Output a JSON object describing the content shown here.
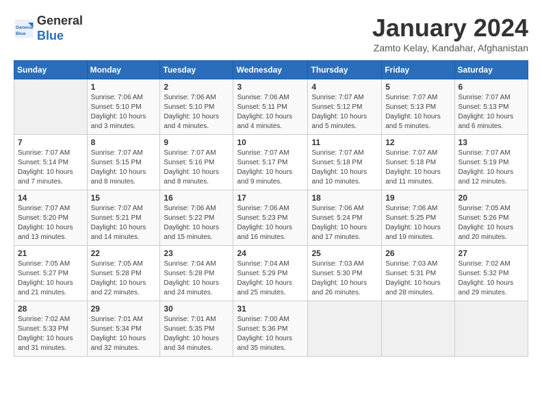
{
  "header": {
    "logo_general": "General",
    "logo_blue": "Blue",
    "month_title": "January 2024",
    "location": "Zamto Kelay, Kandahar, Afghanistan"
  },
  "days_of_week": [
    "Sunday",
    "Monday",
    "Tuesday",
    "Wednesday",
    "Thursday",
    "Friday",
    "Saturday"
  ],
  "weeks": [
    [
      {
        "day": "",
        "sunrise": "",
        "sunset": "",
        "daylight": ""
      },
      {
        "day": "1",
        "sunrise": "Sunrise: 7:06 AM",
        "sunset": "Sunset: 5:10 PM",
        "daylight": "Daylight: 10 hours and 3 minutes."
      },
      {
        "day": "2",
        "sunrise": "Sunrise: 7:06 AM",
        "sunset": "Sunset: 5:10 PM",
        "daylight": "Daylight: 10 hours and 4 minutes."
      },
      {
        "day": "3",
        "sunrise": "Sunrise: 7:06 AM",
        "sunset": "Sunset: 5:11 PM",
        "daylight": "Daylight: 10 hours and 4 minutes."
      },
      {
        "day": "4",
        "sunrise": "Sunrise: 7:07 AM",
        "sunset": "Sunset: 5:12 PM",
        "daylight": "Daylight: 10 hours and 5 minutes."
      },
      {
        "day": "5",
        "sunrise": "Sunrise: 7:07 AM",
        "sunset": "Sunset: 5:13 PM",
        "daylight": "Daylight: 10 hours and 5 minutes."
      },
      {
        "day": "6",
        "sunrise": "Sunrise: 7:07 AM",
        "sunset": "Sunset: 5:13 PM",
        "daylight": "Daylight: 10 hours and 6 minutes."
      }
    ],
    [
      {
        "day": "7",
        "sunrise": "Sunrise: 7:07 AM",
        "sunset": "Sunset: 5:14 PM",
        "daylight": "Daylight: 10 hours and 7 minutes."
      },
      {
        "day": "8",
        "sunrise": "Sunrise: 7:07 AM",
        "sunset": "Sunset: 5:15 PM",
        "daylight": "Daylight: 10 hours and 8 minutes."
      },
      {
        "day": "9",
        "sunrise": "Sunrise: 7:07 AM",
        "sunset": "Sunset: 5:16 PM",
        "daylight": "Daylight: 10 hours and 8 minutes."
      },
      {
        "day": "10",
        "sunrise": "Sunrise: 7:07 AM",
        "sunset": "Sunset: 5:17 PM",
        "daylight": "Daylight: 10 hours and 9 minutes."
      },
      {
        "day": "11",
        "sunrise": "Sunrise: 7:07 AM",
        "sunset": "Sunset: 5:18 PM",
        "daylight": "Daylight: 10 hours and 10 minutes."
      },
      {
        "day": "12",
        "sunrise": "Sunrise: 7:07 AM",
        "sunset": "Sunset: 5:18 PM",
        "daylight": "Daylight: 10 hours and 11 minutes."
      },
      {
        "day": "13",
        "sunrise": "Sunrise: 7:07 AM",
        "sunset": "Sunset: 5:19 PM",
        "daylight": "Daylight: 10 hours and 12 minutes."
      }
    ],
    [
      {
        "day": "14",
        "sunrise": "Sunrise: 7:07 AM",
        "sunset": "Sunset: 5:20 PM",
        "daylight": "Daylight: 10 hours and 13 minutes."
      },
      {
        "day": "15",
        "sunrise": "Sunrise: 7:07 AM",
        "sunset": "Sunset: 5:21 PM",
        "daylight": "Daylight: 10 hours and 14 minutes."
      },
      {
        "day": "16",
        "sunrise": "Sunrise: 7:06 AM",
        "sunset": "Sunset: 5:22 PM",
        "daylight": "Daylight: 10 hours and 15 minutes."
      },
      {
        "day": "17",
        "sunrise": "Sunrise: 7:06 AM",
        "sunset": "Sunset: 5:23 PM",
        "daylight": "Daylight: 10 hours and 16 minutes."
      },
      {
        "day": "18",
        "sunrise": "Sunrise: 7:06 AM",
        "sunset": "Sunset: 5:24 PM",
        "daylight": "Daylight: 10 hours and 17 minutes."
      },
      {
        "day": "19",
        "sunrise": "Sunrise: 7:06 AM",
        "sunset": "Sunset: 5:25 PM",
        "daylight": "Daylight: 10 hours and 19 minutes."
      },
      {
        "day": "20",
        "sunrise": "Sunrise: 7:05 AM",
        "sunset": "Sunset: 5:26 PM",
        "daylight": "Daylight: 10 hours and 20 minutes."
      }
    ],
    [
      {
        "day": "21",
        "sunrise": "Sunrise: 7:05 AM",
        "sunset": "Sunset: 5:27 PM",
        "daylight": "Daylight: 10 hours and 21 minutes."
      },
      {
        "day": "22",
        "sunrise": "Sunrise: 7:05 AM",
        "sunset": "Sunset: 5:28 PM",
        "daylight": "Daylight: 10 hours and 22 minutes."
      },
      {
        "day": "23",
        "sunrise": "Sunrise: 7:04 AM",
        "sunset": "Sunset: 5:28 PM",
        "daylight": "Daylight: 10 hours and 24 minutes."
      },
      {
        "day": "24",
        "sunrise": "Sunrise: 7:04 AM",
        "sunset": "Sunset: 5:29 PM",
        "daylight": "Daylight: 10 hours and 25 minutes."
      },
      {
        "day": "25",
        "sunrise": "Sunrise: 7:03 AM",
        "sunset": "Sunset: 5:30 PM",
        "daylight": "Daylight: 10 hours and 26 minutes."
      },
      {
        "day": "26",
        "sunrise": "Sunrise: 7:03 AM",
        "sunset": "Sunset: 5:31 PM",
        "daylight": "Daylight: 10 hours and 28 minutes."
      },
      {
        "day": "27",
        "sunrise": "Sunrise: 7:02 AM",
        "sunset": "Sunset: 5:32 PM",
        "daylight": "Daylight: 10 hours and 29 minutes."
      }
    ],
    [
      {
        "day": "28",
        "sunrise": "Sunrise: 7:02 AM",
        "sunset": "Sunset: 5:33 PM",
        "daylight": "Daylight: 10 hours and 31 minutes."
      },
      {
        "day": "29",
        "sunrise": "Sunrise: 7:01 AM",
        "sunset": "Sunset: 5:34 PM",
        "daylight": "Daylight: 10 hours and 32 minutes."
      },
      {
        "day": "30",
        "sunrise": "Sunrise: 7:01 AM",
        "sunset": "Sunset: 5:35 PM",
        "daylight": "Daylight: 10 hours and 34 minutes."
      },
      {
        "day": "31",
        "sunrise": "Sunrise: 7:00 AM",
        "sunset": "Sunset: 5:36 PM",
        "daylight": "Daylight: 10 hours and 35 minutes."
      },
      {
        "day": "",
        "sunrise": "",
        "sunset": "",
        "daylight": ""
      },
      {
        "day": "",
        "sunrise": "",
        "sunset": "",
        "daylight": ""
      },
      {
        "day": "",
        "sunrise": "",
        "sunset": "",
        "daylight": ""
      }
    ]
  ]
}
